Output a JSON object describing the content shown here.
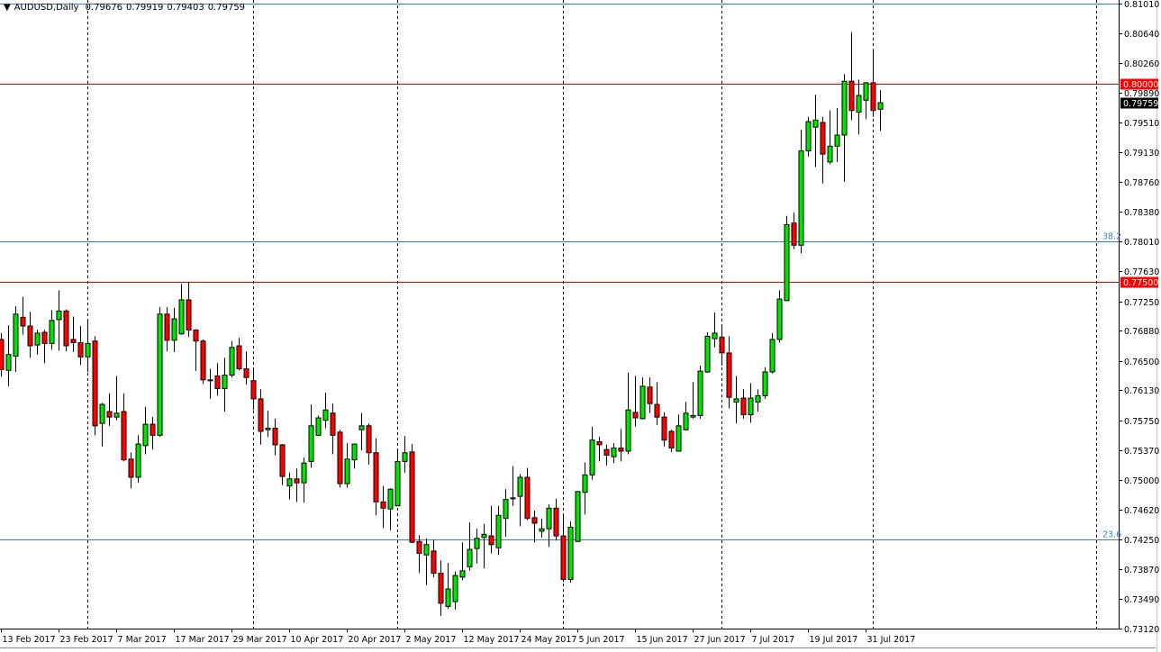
{
  "header": {
    "symbol_timeframe": "AUDUSD,Daily",
    "open": "0.79676",
    "high": "0.79919",
    "low": "0.79403",
    "close": "0.79759"
  },
  "chart_data": {
    "type": "candlestick",
    "title": "AUDUSD,Daily",
    "ylim": [
      0.7312,
      0.8101
    ],
    "y_ticks": [
      "0.81010",
      "0.80640",
      "0.80260",
      "0.79890",
      "0.79510",
      "0.79130",
      "0.78760",
      "0.78380",
      "0.78010",
      "0.77630",
      "0.77250",
      "0.76880",
      "0.76500",
      "0.76130",
      "0.75750",
      "0.75370",
      "0.75000",
      "0.74620",
      "0.74250",
      "0.73870",
      "0.73490",
      "0.73120"
    ],
    "x_ticks": [
      {
        "candle": 0,
        "label": "13 Feb 2017"
      },
      {
        "candle": 8,
        "label": "23 Feb 2017"
      },
      {
        "candle": 16,
        "label": "7 Mar 2017"
      },
      {
        "candle": 24,
        "label": "17 Mar 2017"
      },
      {
        "candle": 32,
        "label": "29 Mar 2017"
      },
      {
        "candle": 40,
        "label": "10 Apr 2017"
      },
      {
        "candle": 48,
        "label": "20 Apr 2017"
      },
      {
        "candle": 56,
        "label": "2 May 2017"
      },
      {
        "candle": 64,
        "label": "12 May 2017"
      },
      {
        "candle": 72,
        "label": "24 May 2017"
      },
      {
        "candle": 80,
        "label": "5 Jun 2017"
      },
      {
        "candle": 88,
        "label": "15 Jun 2017"
      },
      {
        "candle": 96,
        "label": "27 Jun 2017"
      },
      {
        "candle": 104,
        "label": "7 Jul 2017"
      },
      {
        "candle": 112,
        "label": "19 Jul 2017"
      },
      {
        "candle": 120,
        "label": "31 Jul 2017"
      }
    ],
    "period_separators_at_candle": [
      12,
      35,
      55,
      78,
      100,
      121,
      152
    ],
    "horizontal_lines": [
      {
        "price": 0.8101,
        "color": "#3b7fc4",
        "label": ""
      },
      {
        "price": 0.8,
        "color": "#ff0000",
        "label": "",
        "marker": "0.80000"
      },
      {
        "price": 0.7801,
        "color": "#3b7fc4",
        "label": "38.2"
      },
      {
        "price": 0.775,
        "color": "#ff0000",
        "label": "",
        "marker": "0.77500"
      },
      {
        "price": 0.7425,
        "color": "#3b7fc4",
        "label": "23.6"
      }
    ],
    "current_price": {
      "price": 0.79759,
      "label": "0.79759"
    },
    "colors": {
      "bull": "#00e400",
      "bear": "#ff0000",
      "outline": "#000000",
      "grid": "#000000",
      "current_bg": "#000000",
      "marker_bg": "#ff0000"
    },
    "ohlc": [
      [
        0.7677,
        0.7685,
        0.763,
        0.7639
      ],
      [
        0.7638,
        0.7695,
        0.7618,
        0.7658
      ],
      [
        0.7656,
        0.7719,
        0.7636,
        0.7709
      ],
      [
        0.7705,
        0.7731,
        0.7683,
        0.7694
      ],
      [
        0.7694,
        0.7712,
        0.7654,
        0.7669
      ],
      [
        0.767,
        0.7689,
        0.7658,
        0.7685
      ],
      [
        0.7686,
        0.7689,
        0.7647,
        0.7672
      ],
      [
        0.7672,
        0.7714,
        0.7664,
        0.7701
      ],
      [
        0.7702,
        0.7739,
        0.7663,
        0.7713
      ],
      [
        0.7713,
        0.7715,
        0.7662,
        0.7669
      ],
      [
        0.7677,
        0.7706,
        0.7661,
        0.7673
      ],
      [
        0.7673,
        0.7694,
        0.7645,
        0.7655
      ],
      [
        0.7655,
        0.7701,
        0.7636,
        0.7672
      ],
      [
        0.7675,
        0.7681,
        0.7556,
        0.7568
      ],
      [
        0.7571,
        0.7597,
        0.7542,
        0.7595
      ],
      [
        0.7586,
        0.7609,
        0.7568,
        0.7579
      ],
      [
        0.7579,
        0.7631,
        0.7575,
        0.7584
      ],
      [
        0.7586,
        0.7609,
        0.7523,
        0.7525
      ],
      [
        0.7526,
        0.7534,
        0.7489,
        0.7503
      ],
      [
        0.7503,
        0.7556,
        0.7496,
        0.7545
      ],
      [
        0.7543,
        0.7592,
        0.7532,
        0.757
      ],
      [
        0.757,
        0.7579,
        0.7538,
        0.7556
      ],
      [
        0.7556,
        0.7718,
        0.7554,
        0.7709
      ],
      [
        0.7709,
        0.7718,
        0.7662,
        0.7676
      ],
      [
        0.7676,
        0.7717,
        0.7661,
        0.7703
      ],
      [
        0.7684,
        0.7747,
        0.7683,
        0.7727
      ],
      [
        0.7727,
        0.7749,
        0.768,
        0.7689
      ],
      [
        0.7689,
        0.769,
        0.7637,
        0.7675
      ],
      [
        0.7675,
        0.7677,
        0.7621,
        0.7626
      ],
      [
        0.7626,
        0.764,
        0.7602,
        0.7625
      ],
      [
        0.7631,
        0.7647,
        0.7606,
        0.7615
      ],
      [
        0.7615,
        0.7654,
        0.7586,
        0.7632
      ],
      [
        0.7632,
        0.7675,
        0.7629,
        0.7667
      ],
      [
        0.7669,
        0.7679,
        0.7638,
        0.764
      ],
      [
        0.764,
        0.7662,
        0.762,
        0.7629
      ],
      [
        0.7625,
        0.7639,
        0.7588,
        0.7602
      ],
      [
        0.7602,
        0.7614,
        0.7544,
        0.7561
      ],
      [
        0.7563,
        0.7587,
        0.7554,
        0.7565
      ],
      [
        0.7565,
        0.7577,
        0.7531,
        0.7544
      ],
      [
        0.7544,
        0.7545,
        0.7493,
        0.7504
      ],
      [
        0.7492,
        0.7509,
        0.7475,
        0.7501
      ],
      [
        0.7501,
        0.7514,
        0.7472,
        0.7496
      ],
      [
        0.7496,
        0.7528,
        0.7471,
        0.7521
      ],
      [
        0.7523,
        0.7595,
        0.7515,
        0.7568
      ],
      [
        0.7556,
        0.7581,
        0.7555,
        0.7578
      ],
      [
        0.7575,
        0.761,
        0.7565,
        0.7588
      ],
      [
        0.7584,
        0.7596,
        0.7532,
        0.7556
      ],
      [
        0.756,
        0.7563,
        0.749,
        0.7495
      ],
      [
        0.7495,
        0.7546,
        0.749,
        0.7526
      ],
      [
        0.7525,
        0.7545,
        0.7514,
        0.7545
      ],
      [
        0.7563,
        0.7584,
        0.7537,
        0.7568
      ],
      [
        0.7568,
        0.7571,
        0.7519,
        0.7534
      ],
      [
        0.7534,
        0.7552,
        0.7455,
        0.7472
      ],
      [
        0.7472,
        0.7492,
        0.7439,
        0.7464
      ],
      [
        0.7463,
        0.7489,
        0.7436,
        0.7488
      ],
      [
        0.7467,
        0.7539,
        0.7467,
        0.7523
      ],
      [
        0.7523,
        0.7555,
        0.7509,
        0.7534
      ],
      [
        0.7535,
        0.7545,
        0.742,
        0.7421
      ],
      [
        0.7422,
        0.743,
        0.7382,
        0.7407
      ],
      [
        0.7405,
        0.7426,
        0.7367,
        0.7418
      ],
      [
        0.741,
        0.7424,
        0.7377,
        0.7382
      ],
      [
        0.7382,
        0.7398,
        0.7328,
        0.7344
      ],
      [
        0.734,
        0.7395,
        0.7337,
        0.7362
      ],
      [
        0.7346,
        0.7384,
        0.7336,
        0.7379
      ],
      [
        0.7377,
        0.7421,
        0.7373,
        0.7385
      ],
      [
        0.739,
        0.7446,
        0.7385,
        0.7412
      ],
      [
        0.7413,
        0.7438,
        0.7394,
        0.7426
      ],
      [
        0.7427,
        0.7444,
        0.7388,
        0.7431
      ],
      [
        0.7429,
        0.7467,
        0.7407,
        0.7418
      ],
      [
        0.7414,
        0.7467,
        0.7405,
        0.7455
      ],
      [
        0.7451,
        0.7488,
        0.7428,
        0.7475
      ],
      [
        0.7476,
        0.7517,
        0.7467,
        0.7477
      ],
      [
        0.7479,
        0.7507,
        0.7441,
        0.7503
      ],
      [
        0.7503,
        0.7515,
        0.7449,
        0.7451
      ],
      [
        0.7452,
        0.7461,
        0.7421,
        0.7445
      ],
      [
        0.7435,
        0.7451,
        0.7427,
        0.7438
      ],
      [
        0.7438,
        0.7469,
        0.7415,
        0.7464
      ],
      [
        0.7464,
        0.7476,
        0.7423,
        0.7429
      ],
      [
        0.7429,
        0.7455,
        0.7371,
        0.7374
      ],
      [
        0.7374,
        0.7447,
        0.737,
        0.744
      ],
      [
        0.7422,
        0.7485,
        0.7422,
        0.7485
      ],
      [
        0.7484,
        0.7522,
        0.7456,
        0.7506
      ],
      [
        0.7506,
        0.7567,
        0.75,
        0.755
      ],
      [
        0.7548,
        0.7554,
        0.7523,
        0.7544
      ],
      [
        0.7538,
        0.7544,
        0.7518,
        0.7531
      ],
      [
        0.7529,
        0.7546,
        0.7521,
        0.754
      ],
      [
        0.754,
        0.7564,
        0.7523,
        0.7536
      ],
      [
        0.7536,
        0.7635,
        0.7532,
        0.7588
      ],
      [
        0.7585,
        0.7631,
        0.7567,
        0.7578
      ],
      [
        0.7577,
        0.7629,
        0.7576,
        0.7618
      ],
      [
        0.7617,
        0.7629,
        0.7584,
        0.7596
      ],
      [
        0.7595,
        0.7623,
        0.7569,
        0.7579
      ],
      [
        0.7579,
        0.7585,
        0.7542,
        0.755
      ],
      [
        0.7561,
        0.7563,
        0.7535,
        0.754
      ],
      [
        0.7536,
        0.7582,
        0.7536,
        0.7568
      ],
      [
        0.7563,
        0.7598,
        0.7562,
        0.7584
      ],
      [
        0.7579,
        0.7623,
        0.7577,
        0.7581
      ],
      [
        0.7581,
        0.7644,
        0.7577,
        0.7637
      ],
      [
        0.7636,
        0.7686,
        0.7635,
        0.7681
      ],
      [
        0.7678,
        0.7711,
        0.7667,
        0.7685
      ],
      [
        0.768,
        0.7695,
        0.7644,
        0.766
      ],
      [
        0.766,
        0.7681,
        0.759,
        0.7604
      ],
      [
        0.7598,
        0.7631,
        0.7571,
        0.7602
      ],
      [
        0.7603,
        0.7614,
        0.7577,
        0.7582
      ],
      [
        0.7582,
        0.7622,
        0.7572,
        0.7603
      ],
      [
        0.7598,
        0.7614,
        0.7586,
        0.7606
      ],
      [
        0.7606,
        0.7642,
        0.7602,
        0.7636
      ],
      [
        0.7636,
        0.7685,
        0.7634,
        0.7677
      ],
      [
        0.7677,
        0.7739,
        0.7673,
        0.7728
      ],
      [
        0.7726,
        0.7833,
        0.7726,
        0.7822
      ],
      [
        0.7824,
        0.7837,
        0.7791,
        0.7796
      ],
      [
        0.7796,
        0.7942,
        0.7786,
        0.7915
      ],
      [
        0.7915,
        0.7958,
        0.7908,
        0.7952
      ],
      [
        0.7945,
        0.7986,
        0.7895,
        0.7954
      ],
      [
        0.7951,
        0.7958,
        0.7874,
        0.7911
      ],
      [
        0.7901,
        0.7966,
        0.7898,
        0.7921
      ],
      [
        0.7921,
        0.7969,
        0.7901,
        0.7935
      ],
      [
        0.7935,
        0.8012,
        0.7876,
        0.8003
      ],
      [
        0.8003,
        0.8065,
        0.7954,
        0.7966
      ],
      [
        0.7964,
        0.8005,
        0.7936,
        0.7985
      ],
      [
        0.7979,
        0.8002,
        0.7955,
        0.8001
      ],
      [
        0.8001,
        0.8042,
        0.7958,
        0.7966
      ],
      [
        0.79676,
        0.79919,
        0.79403,
        0.79759
      ]
    ]
  }
}
